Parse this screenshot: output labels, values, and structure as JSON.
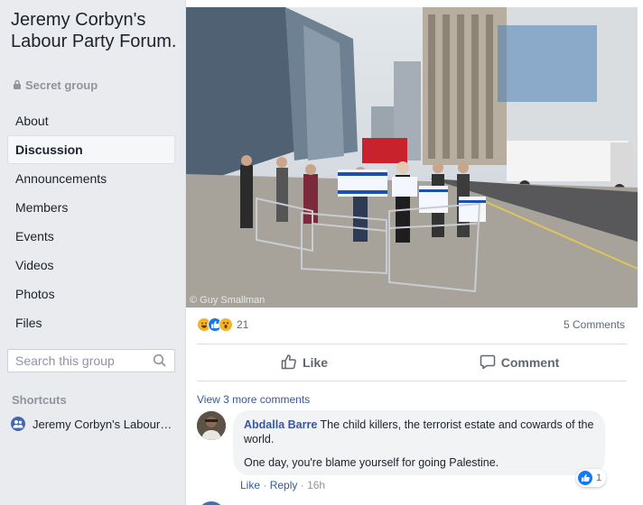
{
  "group": {
    "title": "Jeremy Corbyn's Labour Party Forum.",
    "privacy": "Secret group"
  },
  "nav": {
    "items": [
      "About",
      "Discussion",
      "Announcements",
      "Members",
      "Events",
      "Videos",
      "Photos",
      "Files"
    ],
    "active": "Discussion"
  },
  "search": {
    "placeholder": "Search this group"
  },
  "shortcuts": {
    "heading": "Shortcuts",
    "item": "Jeremy Corbyn's Labour Party Forum."
  },
  "post": {
    "photo_credit": "© Guy Smallman",
    "reaction_icons": [
      "haha-icon",
      "like-icon",
      "wow-icon"
    ],
    "reaction_count": "21",
    "comments_count": "5 Comments",
    "like_label": "Like",
    "comment_label": "Comment"
  },
  "comments": {
    "view_more": "View 3 more comments",
    "first": {
      "author": "Abdalla Barre",
      "text1": "The child killers, the terrorist estate and cowards of the world.",
      "text2": "One day, you're blame yourself for going Palestine.",
      "reaction_count": "1",
      "like": "Like",
      "reply": "Reply",
      "time": "16h"
    }
  },
  "colors": {
    "link": "#385898",
    "like_blue": "#1877f2",
    "sidebar_bg": "#e9ebee"
  }
}
